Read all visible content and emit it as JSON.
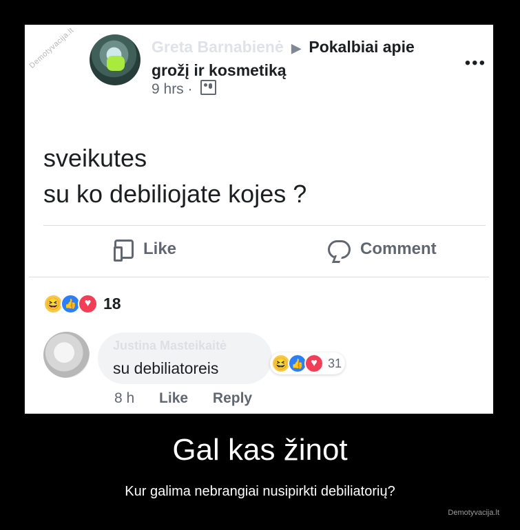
{
  "post": {
    "author_blurred": "Greta Barnabienė",
    "author_visible_tail": "nė",
    "group": "Pokalbiai apie grožį ir kosmetiką",
    "time": "9 hrs",
    "more": "•••",
    "text_line1": "sveikutes",
    "text_line2": "su ko debiliojate kojes ?",
    "like_label": "Like",
    "comment_label": "Comment",
    "reactions_count": "18"
  },
  "comment": {
    "author_blurred": "Justina Masteikaitė",
    "text": "su debiliatoreis",
    "reactions_count": "31",
    "time": "8 h",
    "like": "Like",
    "reply": "Reply"
  },
  "caption": {
    "title": "Gal kas žinot",
    "subtitle": "Kur galima nebrangiai nusipirkti debiliatorių?",
    "site": "Demotyvacija.lt"
  },
  "watermark": "Demotyvacija.lt"
}
